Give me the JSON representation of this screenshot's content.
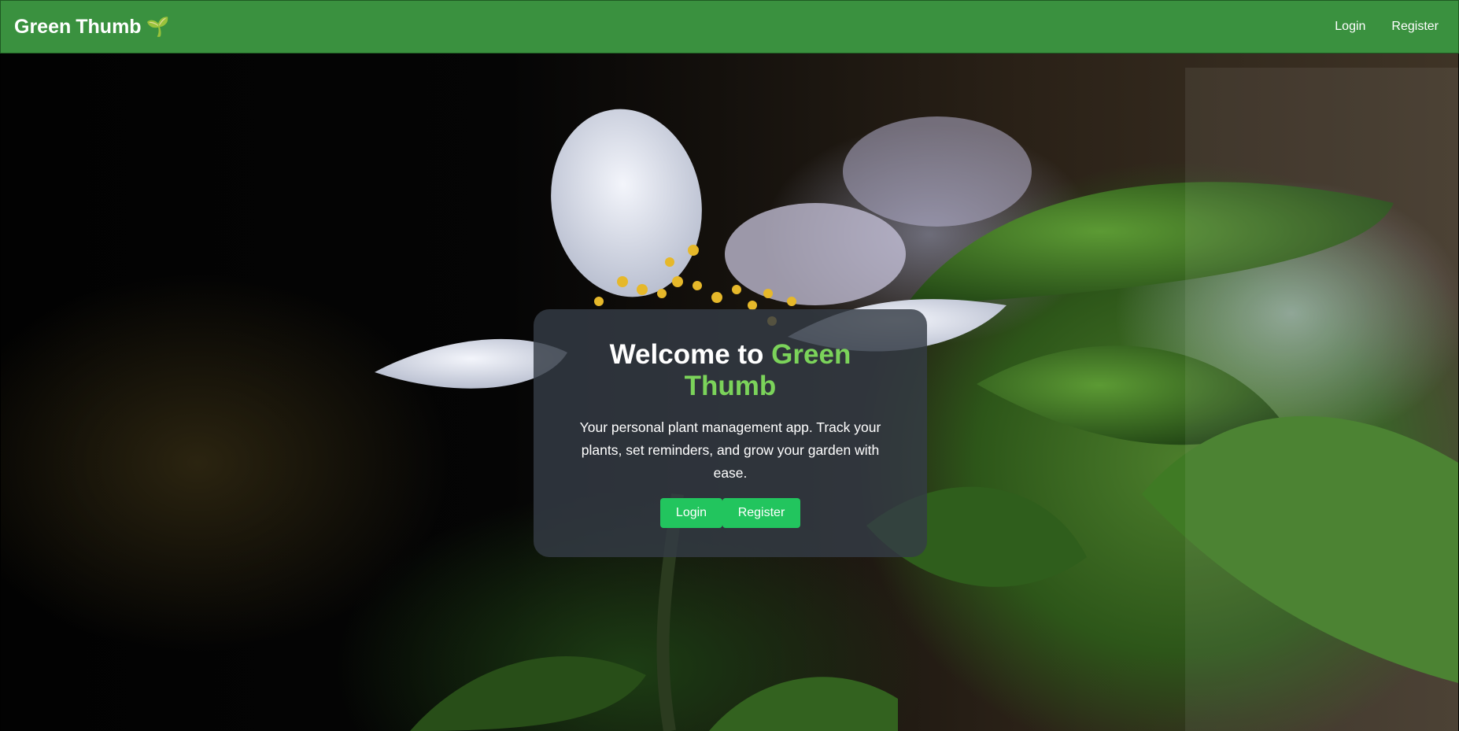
{
  "navbar": {
    "brand_word1": "Green",
    "brand_word2": "Thumb",
    "brand_icon": "🌱",
    "links": [
      "Login",
      "Register"
    ]
  },
  "hero": {
    "title_prefix": "Welcome to",
    "title_accent": "Green Thumb",
    "description": "Your personal plant management app. Track your plants, set reminders, and grow your garden with ease.",
    "login_label": "Login",
    "register_label": "Register"
  },
  "colors": {
    "navbar": "#3a913f",
    "accent_text": "#7bd35a",
    "button": "#22c55e"
  }
}
